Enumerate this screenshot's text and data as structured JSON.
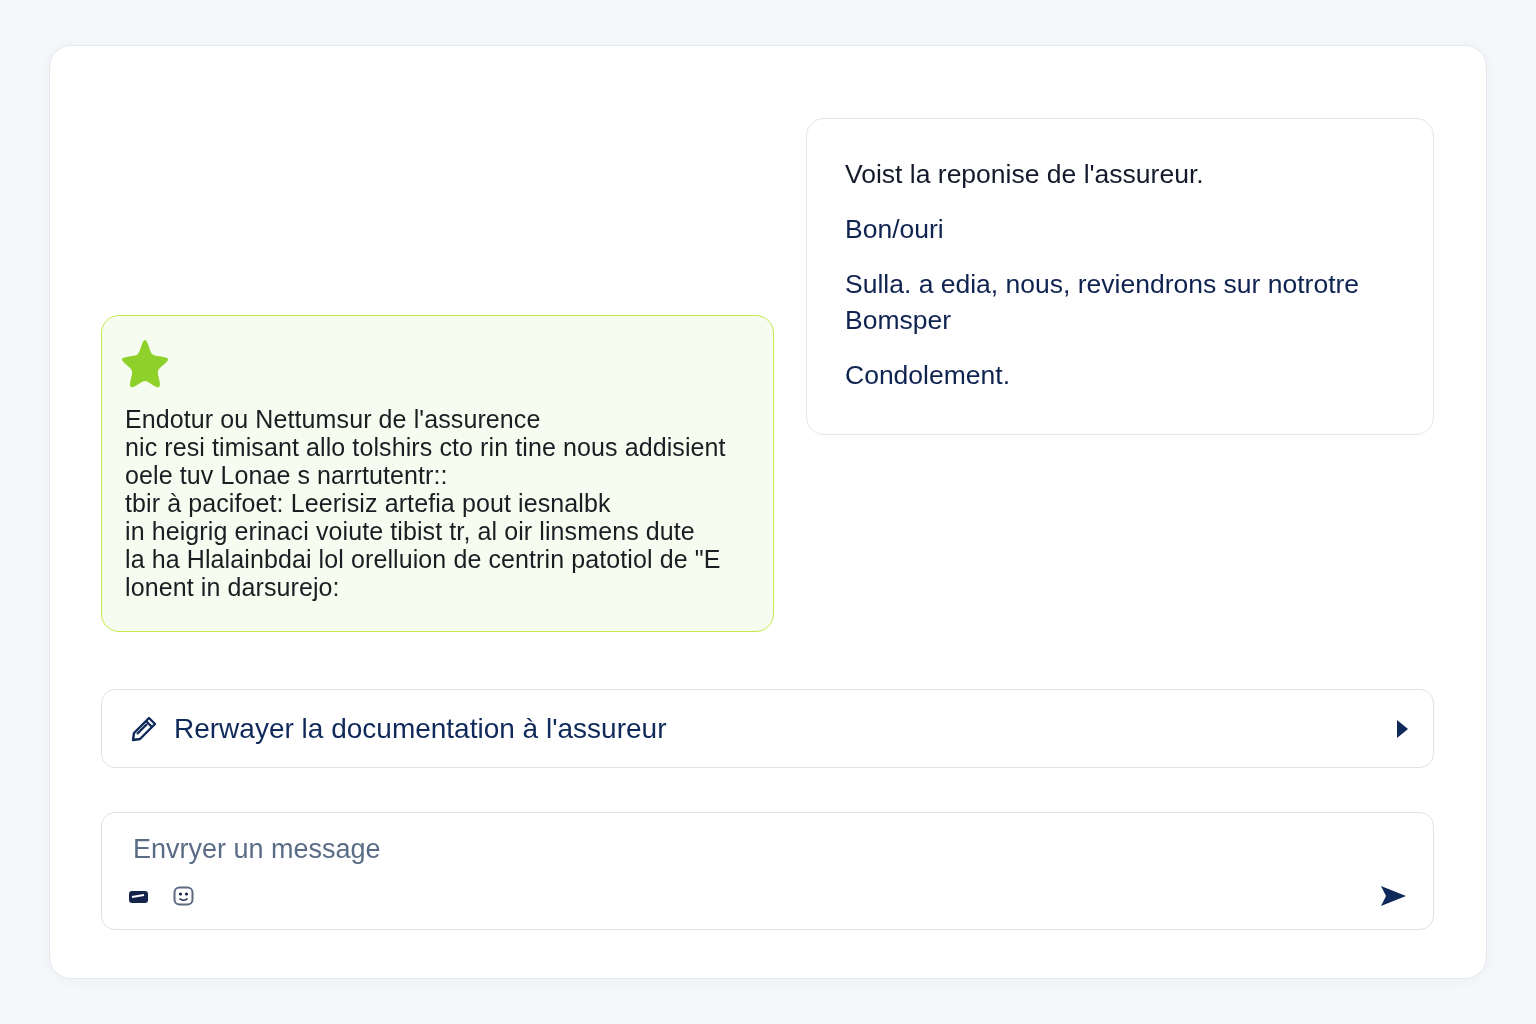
{
  "messages": [
    {
      "kind": "reply",
      "paragraphs": [
        "Voist la reponise de l'assureur.",
        "Bon/ouri",
        "Sulla. a edia, nous, reviendrons sur notrotre Bomsper",
        "Condolement."
      ]
    },
    {
      "kind": "assistant",
      "text": "Endotur ou Nettumsur de l'assurence\nnic resi timisant allo tolshirs cto rin tine nous addisient\noele tuv Lonae s narrtutentr::\ntbir à pacifoet: Leerisiz artefia pout iesnalbk\nin heigrig erinaci voiute tibist tr, al oir linsmens dute\nla ha Hlalainbdai lol orelluion de centrin patotiol de \"E\nlonent in darsurejo:"
    }
  ],
  "action": {
    "label": "Rerwayer la documentation à l'assureur"
  },
  "composer": {
    "placeholder": "Envryer un message"
  }
}
